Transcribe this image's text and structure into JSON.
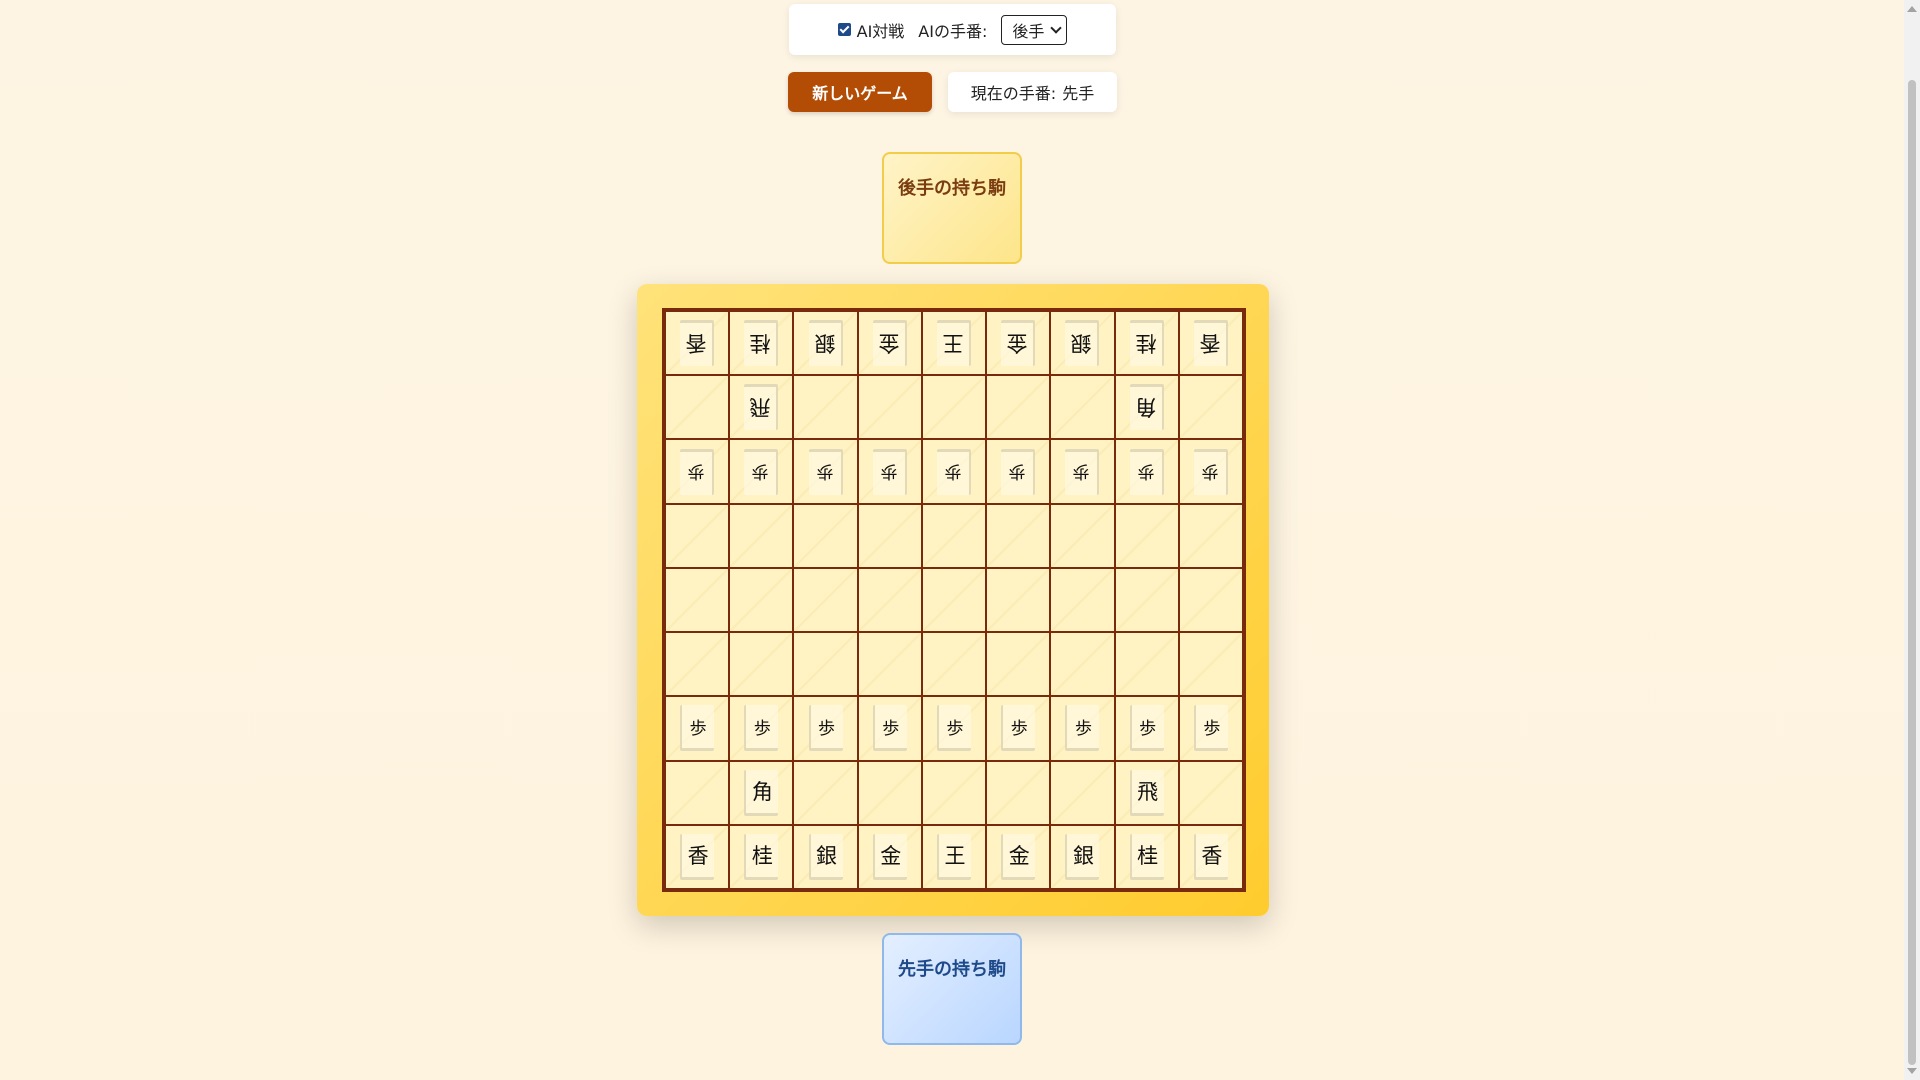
{
  "settings": {
    "ai_label": "AI対戦",
    "ai_side_label": "AIの手番:",
    "ai_side_value": "後手"
  },
  "controls": {
    "new_game_label": "新しいゲーム",
    "turn_label": "現在の手番:",
    "turn_value": "先手"
  },
  "hands": {
    "gote_title": "後手の持ち駒",
    "sente_title": "先手の持ち駒"
  },
  "board": [
    [
      "v香",
      "v桂",
      "v銀",
      "v金",
      "v王",
      "v金",
      "v銀",
      "v桂",
      "v香"
    ],
    [
      "",
      "v飛",
      "",
      "",
      "",
      "",
      "",
      "v角",
      ""
    ],
    [
      "v歩",
      "v歩",
      "v歩",
      "v歩",
      "v歩",
      "v歩",
      "v歩",
      "v歩",
      "v歩"
    ],
    [
      "",
      "",
      "",
      "",
      "",
      "",
      "",
      "",
      ""
    ],
    [
      "",
      "",
      "",
      "",
      "",
      "",
      "",
      "",
      ""
    ],
    [
      "",
      "",
      "",
      "",
      "",
      "",
      "",
      "",
      ""
    ],
    [
      "歩",
      "歩",
      "歩",
      "歩",
      "歩",
      "歩",
      "歩",
      "歩",
      "歩"
    ],
    [
      "",
      "角",
      "",
      "",
      "",
      "",
      "",
      "飛",
      ""
    ],
    [
      "香",
      "桂",
      "銀",
      "金",
      "王",
      "金",
      "銀",
      "桂",
      "香"
    ]
  ]
}
